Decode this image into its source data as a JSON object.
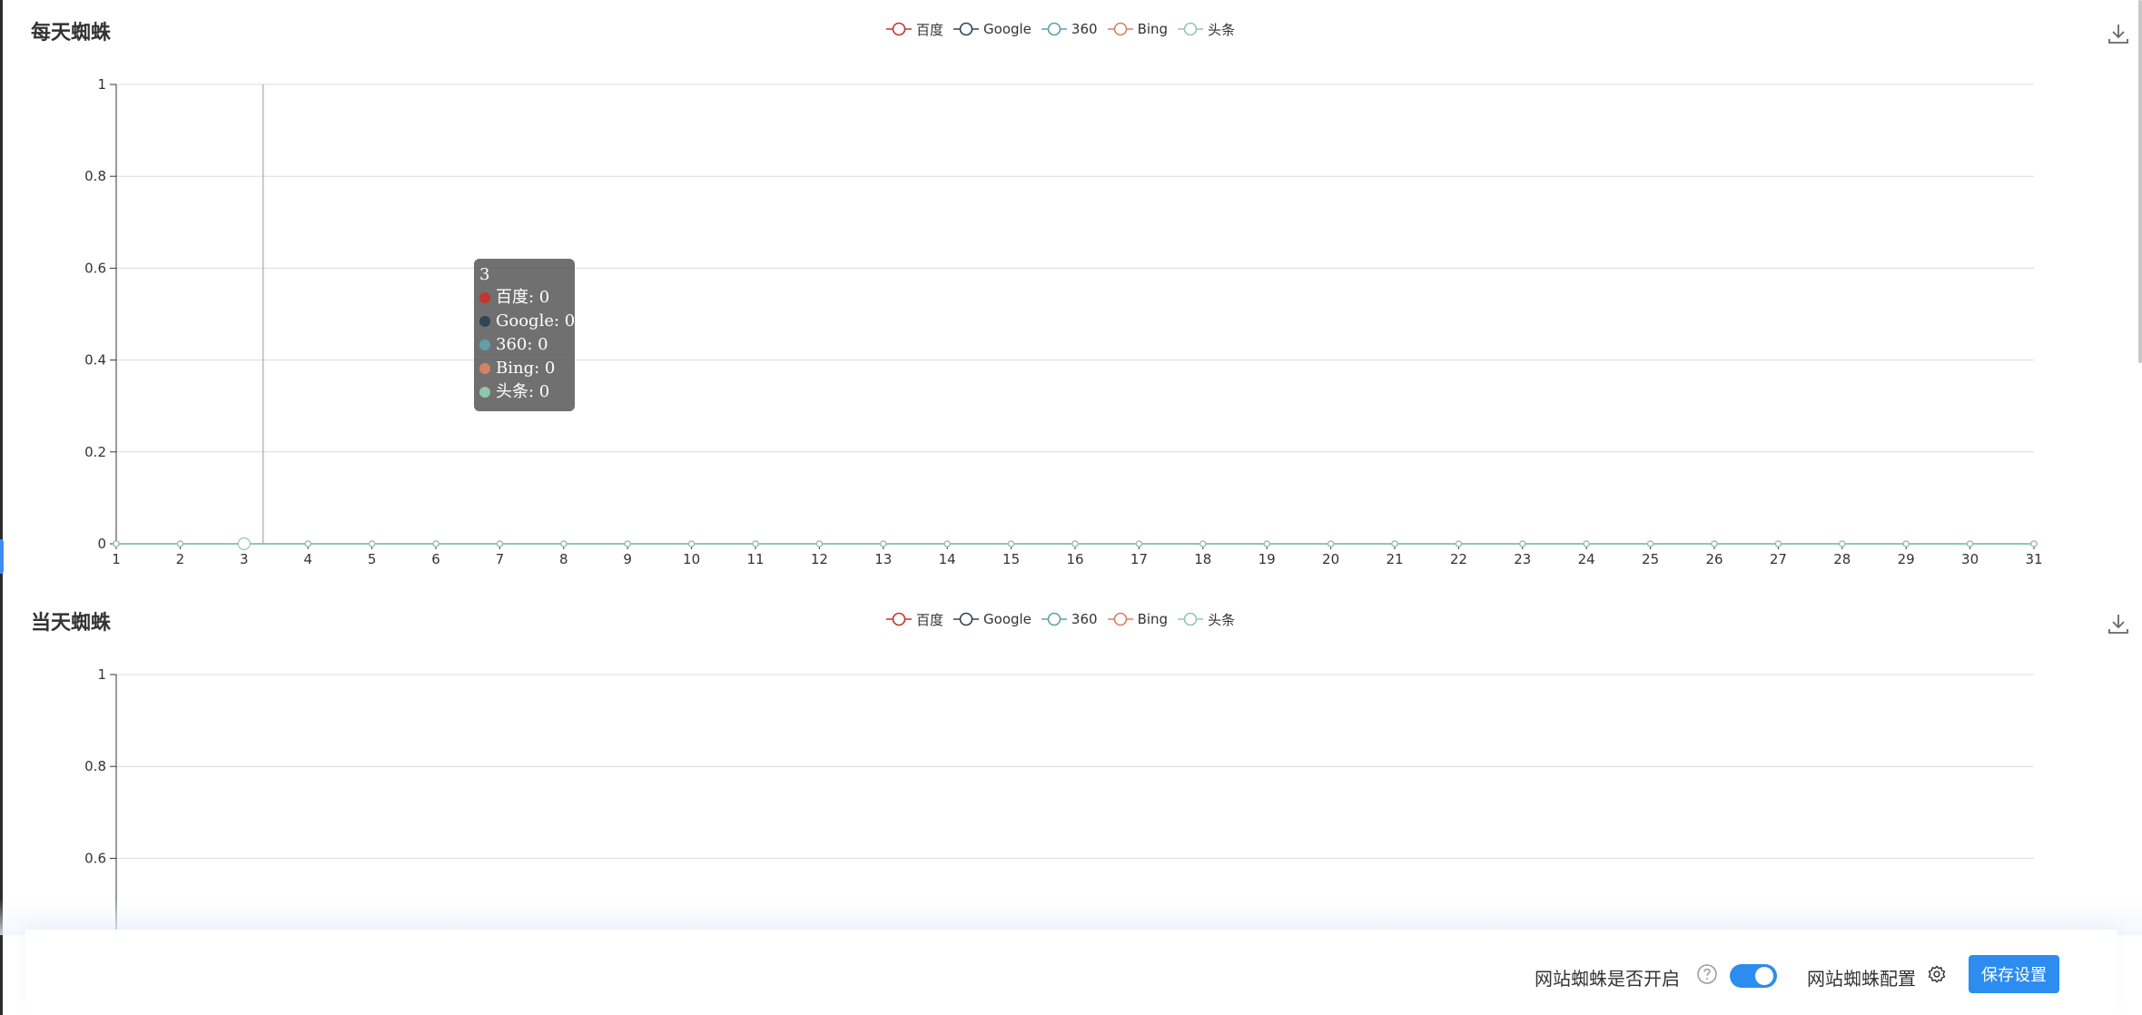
{
  "colors": {
    "baidu": "#c23531",
    "google": "#2f4554",
    "s360": "#61a0a8",
    "bing": "#d48265",
    "toutiao": "#91c7ae",
    "primary": "#2d8cf0"
  },
  "legend": [
    "百度",
    "Google",
    "360",
    "Bing",
    "头条"
  ],
  "daily_panel": {
    "title": "每天蜘蛛",
    "download_icon": "download-icon"
  },
  "current_panel": {
    "title": "当天蜘蛛",
    "download_icon": "download-icon"
  },
  "tooltip": {
    "title": "3",
    "rows": [
      "百度: 0",
      "Google: 0",
      "360: 0",
      "Bing: 0",
      "头条: 0"
    ]
  },
  "chart_data": [
    {
      "type": "line",
      "title": "每天蜘蛛",
      "categories": [
        "1",
        "2",
        "3",
        "4",
        "5",
        "6",
        "7",
        "8",
        "9",
        "10",
        "11",
        "12",
        "13",
        "14",
        "15",
        "16",
        "17",
        "18",
        "19",
        "20",
        "21",
        "22",
        "23",
        "24",
        "25",
        "26",
        "27",
        "28",
        "29",
        "30",
        "31"
      ],
      "y_ticks": [
        "0",
        "0.2",
        "0.4",
        "0.6",
        "0.8",
        "1"
      ],
      "ylim": [
        0,
        1
      ],
      "legend_position": "top-center",
      "grid": true,
      "series": [
        {
          "name": "百度",
          "values": [
            0,
            0,
            0,
            0,
            0,
            0,
            0,
            0,
            0,
            0,
            0,
            0,
            0,
            0,
            0,
            0,
            0,
            0,
            0,
            0,
            0,
            0,
            0,
            0,
            0,
            0,
            0,
            0,
            0,
            0,
            0
          ]
        },
        {
          "name": "Google",
          "values": [
            0,
            0,
            0,
            0,
            0,
            0,
            0,
            0,
            0,
            0,
            0,
            0,
            0,
            0,
            0,
            0,
            0,
            0,
            0,
            0,
            0,
            0,
            0,
            0,
            0,
            0,
            0,
            0,
            0,
            0,
            0
          ]
        },
        {
          "name": "360",
          "values": [
            0,
            0,
            0,
            0,
            0,
            0,
            0,
            0,
            0,
            0,
            0,
            0,
            0,
            0,
            0,
            0,
            0,
            0,
            0,
            0,
            0,
            0,
            0,
            0,
            0,
            0,
            0,
            0,
            0,
            0,
            0
          ]
        },
        {
          "name": "Bing",
          "values": [
            0,
            0,
            0,
            0,
            0,
            0,
            0,
            0,
            0,
            0,
            0,
            0,
            0,
            0,
            0,
            0,
            0,
            0,
            0,
            0,
            0,
            0,
            0,
            0,
            0,
            0,
            0,
            0,
            0,
            0,
            0
          ]
        },
        {
          "name": "头条",
          "values": [
            0,
            0,
            0,
            0,
            0,
            0,
            0,
            0,
            0,
            0,
            0,
            0,
            0,
            0,
            0,
            0,
            0,
            0,
            0,
            0,
            0,
            0,
            0,
            0,
            0,
            0,
            0,
            0,
            0,
            0,
            0
          ]
        }
      ]
    },
    {
      "type": "line",
      "title": "当天蜘蛛",
      "y_ticks": [
        "0.6",
        "0.8",
        "1"
      ],
      "ylim": [
        0,
        1
      ],
      "legend_position": "top-center",
      "grid": true,
      "series": [
        {
          "name": "百度",
          "values": []
        },
        {
          "name": "Google",
          "values": []
        },
        {
          "name": "360",
          "values": []
        },
        {
          "name": "Bing",
          "values": []
        },
        {
          "name": "头条",
          "values": []
        }
      ]
    }
  ],
  "footer": {
    "switch_label": "网站蜘蛛是否开启",
    "switch_on": true,
    "config_label": "网站蜘蛛配置",
    "save_label": "保存设置"
  }
}
